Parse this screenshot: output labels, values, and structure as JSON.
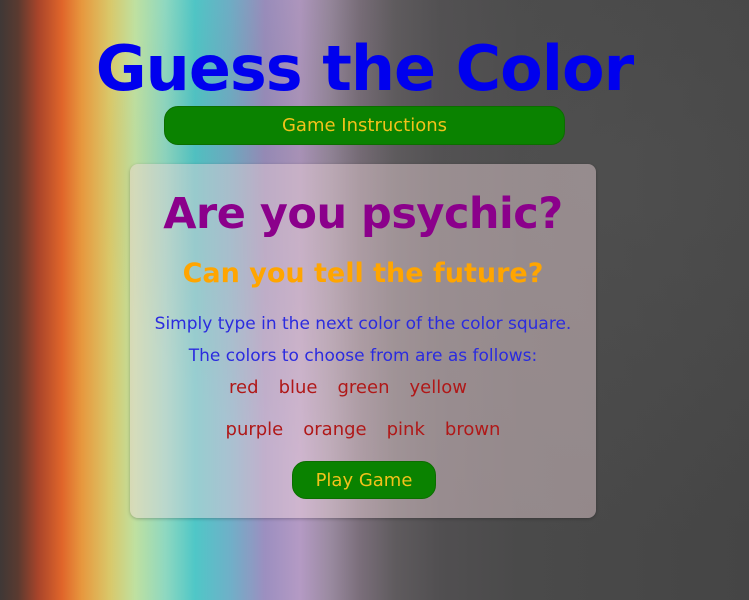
{
  "header": {
    "title": "Guess the Color",
    "instructions_button": "Game Instructions"
  },
  "card": {
    "heading": "Are you psychic?",
    "subheading": "Can you tell the future?",
    "line1": "Simply type in the next color of the color square.",
    "line2": "The colors to choose from are as follows:",
    "colors_row1": [
      "red",
      "blue",
      "green",
      "yellow"
    ],
    "colors_row2": [
      "purple",
      "orange",
      "pink",
      "brown"
    ],
    "play_button": "Play Game"
  },
  "colors": {
    "title": "#0000ee",
    "button_bg": "#0a8200",
    "button_text": "#f2c21a",
    "heading": "#8b008b",
    "subheading": "#ffa500",
    "body_text": "#2b2bdf",
    "color_words": "#b01818"
  }
}
